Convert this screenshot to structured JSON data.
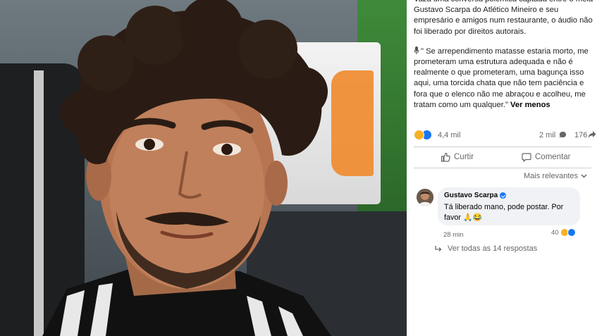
{
  "post": {
    "paragraph1": "Vaza uma conversa polêmica captada entre o meia Gustavo Scarpa do Atlético Mineiro e seu empresário e amigos num restaurante, o áudio não foi liberado por direitos autorais.",
    "paragraph2": "\" Se arrependimento matasse estaria morto, me prometeram uma estrutura adequada e não é realmente o que prometeram, uma bagunça isso aqui, uma torcida chata que não tem paciência e fora que o elenco não me abraçou e acolheu, me tratam como um qualquer.\"",
    "see_less": "Ver menos"
  },
  "reactions": {
    "count": "4,4 mil",
    "comments": "2 mil",
    "shares": "176",
    "icons": [
      "haha-icon",
      "like-icon"
    ]
  },
  "actions": {
    "like": "Curtir",
    "comment": "Comentar"
  },
  "sort": {
    "label": "Mais relevantes"
  },
  "comment": {
    "author": "Gustavo Scarpa",
    "text": "Tá liberado mano, pode postar. Por favor 🙏😂",
    "time": "28 min",
    "reaction_count": "40",
    "replies": "Ver todas as 14 respostas"
  },
  "colors": {
    "link_blue": "#1877f2",
    "meta_gray": "#65676b",
    "bubble_bg": "#f0f2f5",
    "haha_yellow": "#f7b125"
  }
}
